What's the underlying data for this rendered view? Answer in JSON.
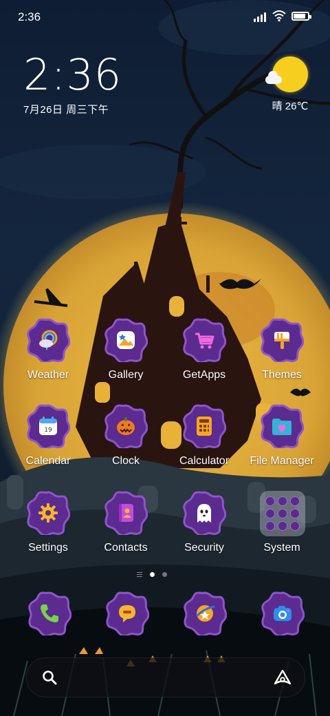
{
  "status_bar": {
    "time": "2:36",
    "signal_icon": "signal-bars-icon",
    "wifi_icon": "wifi-icon",
    "battery_icon": "battery-icon",
    "battery_level": 0.85
  },
  "clock_widget": {
    "time": "2:36",
    "date": "7月26日 周三下午"
  },
  "weather_widget": {
    "icon": "sunny-cloud-icon",
    "text": "晴 26℃"
  },
  "apps": [
    {
      "label": "Weather",
      "icon": "weather-icon"
    },
    {
      "label": "Gallery",
      "icon": "gallery-icon"
    },
    {
      "label": "GetApps",
      "icon": "getapps-cart-icon"
    },
    {
      "label": "Themes",
      "icon": "themes-brush-icon"
    },
    {
      "label": "Calendar",
      "icon": "calendar-icon",
      "icon_text": "19"
    },
    {
      "label": "Clock",
      "icon": "pumpkin-clock-icon"
    },
    {
      "label": "Calculator",
      "icon": "calculator-icon"
    },
    {
      "label": "File Manager",
      "icon": "folder-heart-icon"
    },
    {
      "label": "Settings",
      "icon": "gear-icon"
    },
    {
      "label": "Contacts",
      "icon": "contacts-book-icon"
    },
    {
      "label": "Security",
      "icon": "ghost-shield-icon"
    },
    {
      "label": "System",
      "icon": "system-folder-icon"
    }
  ],
  "page_indicator": {
    "pages": 2,
    "current": 1
  },
  "dock": [
    {
      "icon": "phone-icon"
    },
    {
      "icon": "messages-icon"
    },
    {
      "icon": "browser-icon"
    },
    {
      "icon": "camera-icon"
    }
  ],
  "search_bar": {
    "search_icon": "search-icon",
    "assistant_icon": "assistant-icon"
  },
  "colors": {
    "badge_purple": "#5b2b8f",
    "badge_rim": "#8e55c8",
    "moon": "#e4b23a",
    "night_sky": "#0f2036"
  }
}
